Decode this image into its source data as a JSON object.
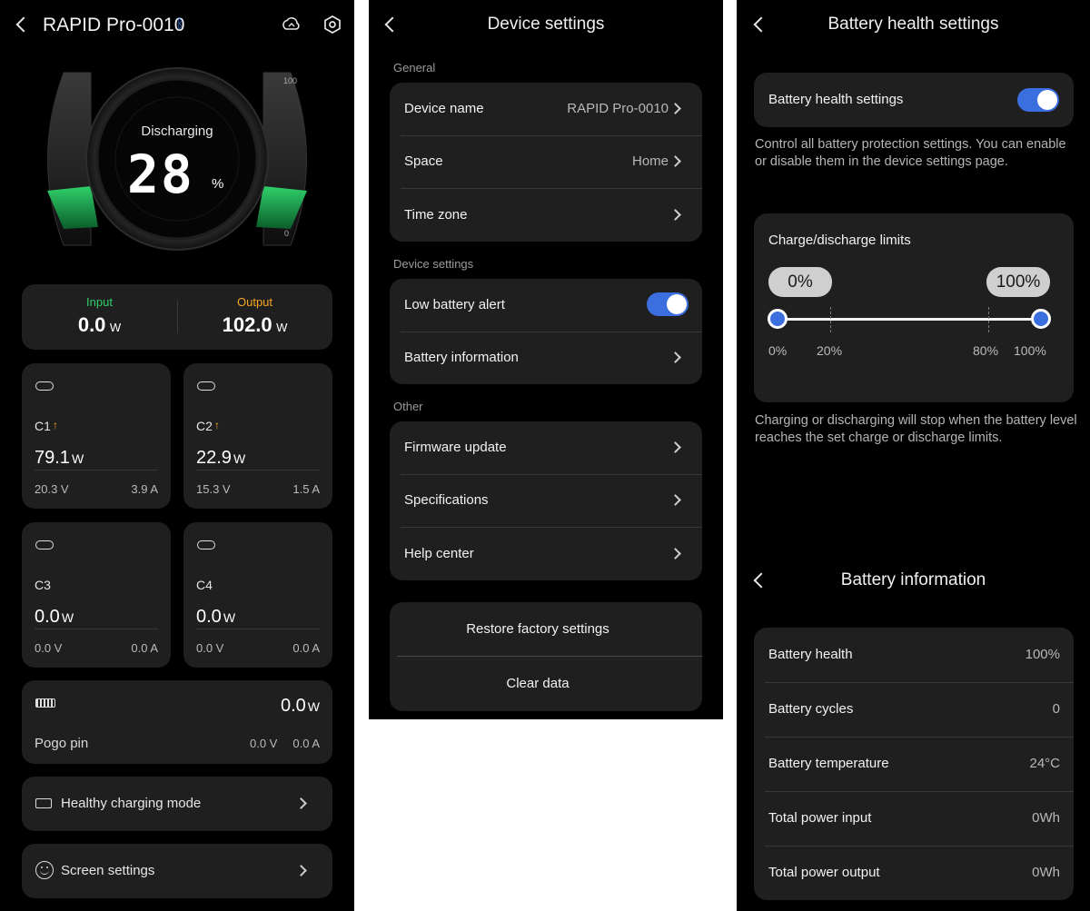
{
  "main": {
    "device_name": "RAPID Pro-0010",
    "bluetooth_icon": "bluetooth-icon",
    "status": "Discharging",
    "percent": "28",
    "percent_sign": "%",
    "gauge_max_label": "100",
    "gauge_min_label": "0",
    "input_label": "Input",
    "input_value": "0.0",
    "input_unit": "W",
    "output_label": "Output",
    "output_value": "102.0",
    "output_unit": "W",
    "accent_green": "#2fd06a",
    "accent_orange": "#f5a623",
    "ports": [
      {
        "name": "C1",
        "power": "79.1",
        "unit": "W",
        "voltage": "20.3 V",
        "current": "3.9 A",
        "active": true
      },
      {
        "name": "C2",
        "power": "22.9",
        "unit": "W",
        "voltage": "15.3 V",
        "current": "1.5 A",
        "active": true
      },
      {
        "name": "C3",
        "power": "0.0",
        "unit": "W",
        "voltage": "0.0 V",
        "current": "0.0 A",
        "active": false
      },
      {
        "name": "C4",
        "power": "0.0",
        "unit": "W",
        "voltage": "0.0 V",
        "current": "0.0 A",
        "active": false
      }
    ],
    "pogo": {
      "name": "Pogo pin",
      "power": "0.0",
      "unit": "W",
      "voltage": "0.0 V",
      "current": "0.0 A"
    },
    "healthy_charging_label": "Healthy charging mode",
    "screen_settings_label": "Screen settings"
  },
  "device_settings": {
    "title": "Device settings",
    "general_header": "General",
    "device_name_label": "Device name",
    "device_name_value": "RAPID Pro-0010",
    "space_label": "Space",
    "space_value": "Home",
    "time_zone_label": "Time zone",
    "device_settings_header": "Device settings",
    "low_battery_label": "Low battery alert",
    "low_battery_on": true,
    "battery_info_label": "Battery information",
    "other_header": "Other",
    "firmware_label": "Firmware update",
    "specifications_label": "Specifications",
    "help_label": "Help center",
    "restore_label": "Restore factory settings",
    "clear_label": "Clear data"
  },
  "battery_health": {
    "title": "Battery health settings",
    "toggle_label": "Battery health settings",
    "toggle_on": true,
    "description": "Control all battery protection settings. You can enable or disable them in the device settings page.",
    "limits_title": "Charge/discharge limits",
    "lower_limit": "0%",
    "upper_limit": "100%",
    "ticks": [
      "0%",
      "20%",
      "80%",
      "100%"
    ],
    "footer": "Charging or discharging will stop when the battery level reaches the set charge or discharge limits."
  },
  "battery_info": {
    "title": "Battery information",
    "rows": [
      {
        "label": "Battery health",
        "value": "100%"
      },
      {
        "label": "Battery cycles",
        "value": "0"
      },
      {
        "label": "Battery temperature",
        "value": "24°C"
      },
      {
        "label": "Total power input",
        "value": "0Wh"
      },
      {
        "label": "Total power output",
        "value": "0Wh"
      }
    ]
  }
}
